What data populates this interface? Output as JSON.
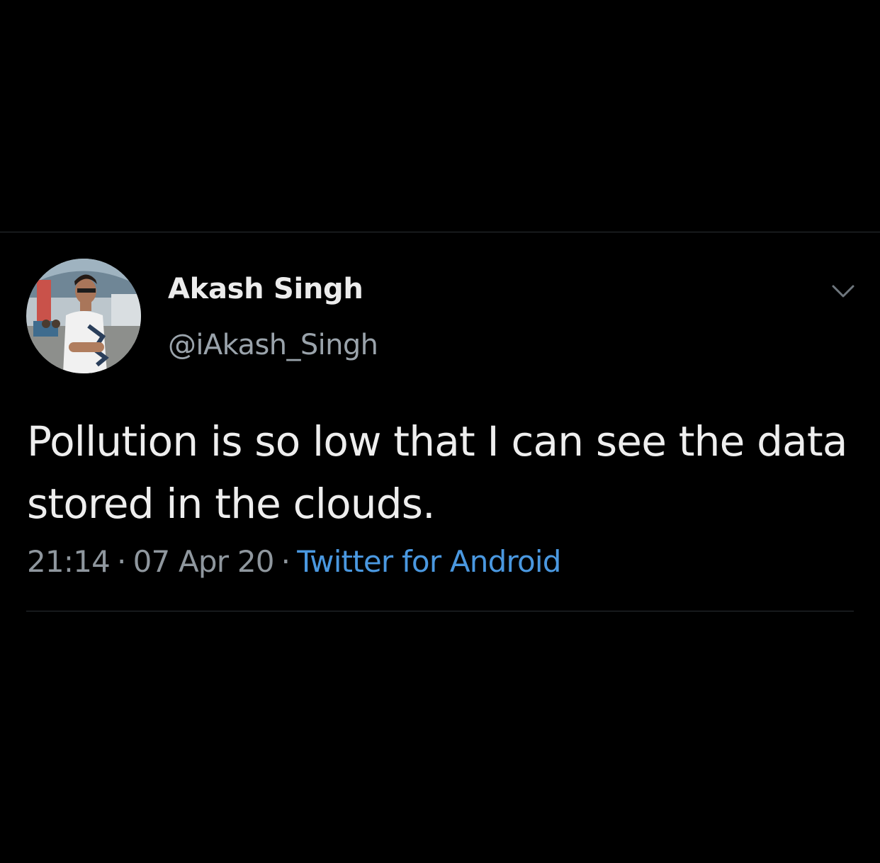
{
  "tweet": {
    "author": {
      "display_name": "Akash Singh",
      "handle": "@iAkash_Singh",
      "avatar_icon": "profile-photo-avatar"
    },
    "text": "Pollution is so low that I can see the data stored in the clouds.",
    "time": "21:14",
    "date": "07 Apr 20",
    "separator": "·",
    "source": "Twitter for Android",
    "menu_icon": "chevron-down-icon"
  },
  "colors": {
    "background": "#000000",
    "text_primary": "#eeeeee",
    "text_secondary": "#8f979e",
    "link": "#4a98e0",
    "divider": "#2a2f33"
  }
}
